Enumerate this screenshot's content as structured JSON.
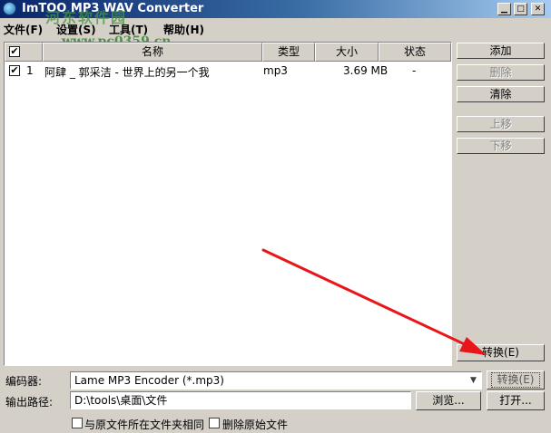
{
  "window": {
    "title": "ImTOO MP3 WAV Converter"
  },
  "menu": [
    {
      "label": "文件(F)"
    },
    {
      "label": "设置(S)"
    },
    {
      "label": "工具(T)"
    },
    {
      "label": "帮助(H)"
    }
  ],
  "watermark": {
    "line1": "河东软件园",
    "line2": "www.pc0359.cn"
  },
  "table": {
    "columns": [
      "",
      "名称",
      "类型",
      "大小",
      "状态"
    ],
    "rows": [
      {
        "checked": true,
        "index": "1",
        "name": "阿肆 _ 郭采洁 - 世界上的另一个我",
        "type": "mp3",
        "size": "3.69 MB",
        "status": "-"
      }
    ]
  },
  "side_buttons": {
    "add": "添加",
    "delete": "删除",
    "clear": "清除",
    "up": "上移",
    "down": "下移",
    "convert": "转换(E)"
  },
  "encoder": {
    "label": "编码器:",
    "value": "Lame MP3 Encoder    (*.mp3)",
    "convert_button": "转换(E)"
  },
  "output": {
    "label": "输出路径:",
    "value": "D:\\tools\\桌面\\文件",
    "browse_button": "浏览...",
    "open_button": "打开..."
  },
  "options": {
    "same_folder": "与原文件所在文件夹相同",
    "delete_original": "删除原始文件"
  },
  "colors": {
    "arrow": "#e8151b",
    "titlebar": "#0a246a"
  }
}
